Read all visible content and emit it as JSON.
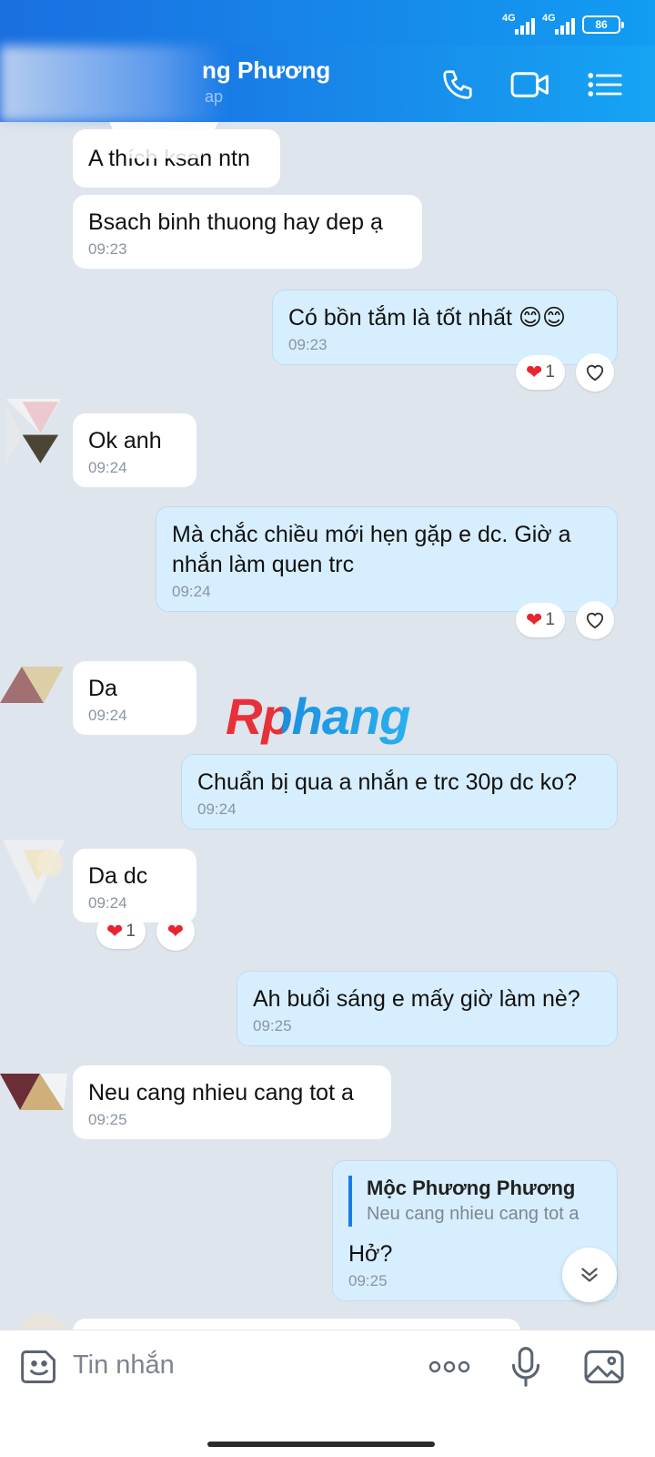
{
  "status_bar": {
    "network_1": "4G",
    "network_2": "4G",
    "battery": "86"
  },
  "header": {
    "contact_name": "ng Phương",
    "subtitle": "ap",
    "call_icon": "phone-icon",
    "video_icon": "video-camera-icon",
    "menu_icon": "list-icon"
  },
  "messages": [
    {
      "id": "m0",
      "side": "in",
      "text": "A thích ksan ntn",
      "time": ""
    },
    {
      "id": "m1",
      "side": "in",
      "text": "Bsach binh thuong hay dep ạ",
      "time": "09:23"
    },
    {
      "id": "m2",
      "side": "out",
      "text": "Có bồn tắm là tốt nhất 😊😊",
      "time": "09:23",
      "reaction_count": "1"
    },
    {
      "id": "m3",
      "side": "in",
      "text": "Ok anh",
      "time": "09:24"
    },
    {
      "id": "m4",
      "side": "out",
      "text": "Mà chắc chiều mới hẹn gặp e dc. Giờ a nhắn làm quen trc",
      "time": "09:24",
      "reaction_count": "1"
    },
    {
      "id": "m5",
      "side": "in",
      "text": "Da",
      "time": "09:24"
    },
    {
      "id": "m6",
      "side": "out",
      "text": "Chuẩn bị qua a nhắn e trc 30p dc ko?",
      "time": "09:24"
    },
    {
      "id": "m7",
      "side": "in",
      "text": "Da dc",
      "time": "09:24",
      "reaction_count": "1"
    },
    {
      "id": "m8",
      "side": "out",
      "text": "Ah buổi sáng e mấy giờ làm nè?",
      "time": "09:25"
    },
    {
      "id": "m9",
      "side": "in",
      "text": "Neu cang nhieu cang tot a",
      "time": "09:25"
    },
    {
      "id": "m10",
      "side": "out",
      "text": "Hở?",
      "time": "09:25",
      "quote_name": "Mộc Phương Phương",
      "quote_text": "Neu cang nhieu cang tot a"
    }
  ],
  "watermark": "Rphang",
  "colors": {
    "accent": "#1a7be6",
    "header_start": "#1a67df",
    "header_end": "#16a4f3",
    "outgoing_bubble": "#d7eefe",
    "heart": "#e8242f"
  },
  "input_bar": {
    "placeholder": "Tin nhắn",
    "sticker_icon": "sticker-face-icon",
    "more_icon": "more-dots-icon",
    "mic_icon": "microphone-icon",
    "image_icon": "image-icon"
  }
}
